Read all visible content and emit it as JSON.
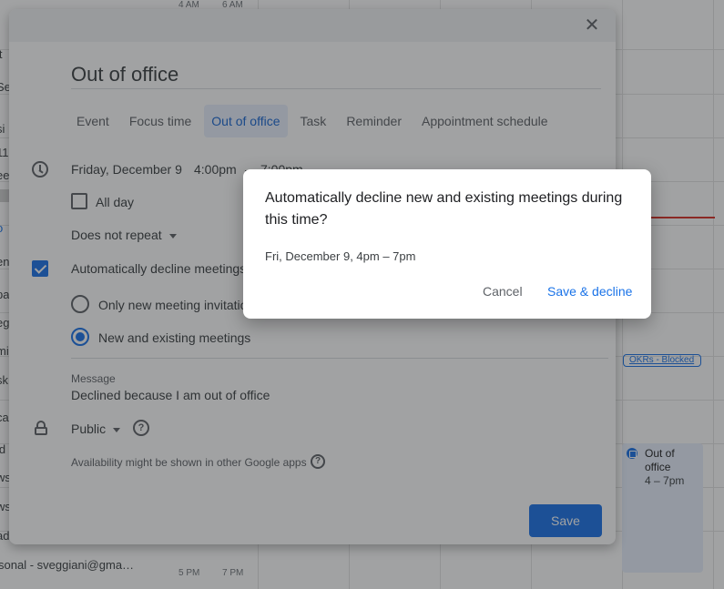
{
  "calendar": {
    "top_times": [
      "4 AM",
      "6 AM"
    ],
    "bottom_times": [
      "5 PM",
      "7 PM"
    ],
    "sidebar_fragments": [
      "it",
      "Se",
      "si",
      "11",
      "ee",
      "o",
      "en",
      "pa",
      "eg",
      "mi",
      "sk",
      "ca",
      "id",
      "ws",
      "ws",
      "ad"
    ],
    "account_label": "sonal - sveggiani@gma…",
    "okr_chip": "OKRs - Blocked",
    "ooo_event": {
      "title": "Out of office",
      "time": "4 – 7pm"
    },
    "colors": {
      "accent": "#1a73e8",
      "now_line": "#d93025",
      "event_bg": "#e8f0fe"
    }
  },
  "editor": {
    "close_icon": "close-icon",
    "title_value": "Out of office",
    "tabs": [
      {
        "label": "Event"
      },
      {
        "label": "Focus time"
      },
      {
        "label": "Out of office"
      },
      {
        "label": "Task"
      },
      {
        "label": "Reminder"
      },
      {
        "label": "Appointment schedule"
      }
    ],
    "active_tab": "Out of office",
    "date": "Friday, December 9",
    "start_time": "4:00pm",
    "dash": "–",
    "end_time": "7:00pm",
    "all_day_label": "All day",
    "repeat_label": "Does not repeat",
    "auto_decline_label": "Automatically decline meetings",
    "radio_new_only": "Only new meeting invitations",
    "radio_new_existing": "New and existing meetings",
    "message_label": "Message",
    "message_value": "Declined because I am out of office",
    "visibility_label": "Public",
    "availability_note": "Availability might be shown in other Google apps",
    "save_label": "Save"
  },
  "confirm": {
    "title": "Automatically decline new and existing meetings during this time?",
    "body": "Fri, December 9, 4pm – 7pm",
    "cancel_label": "Cancel",
    "ok_label": "Save & decline"
  }
}
